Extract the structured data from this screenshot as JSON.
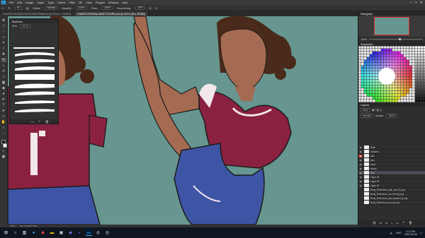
{
  "menubar": {
    "items": [
      "File",
      "Edit",
      "Image",
      "Layer",
      "Type",
      "Select",
      "Filter",
      "3D",
      "View",
      "Plugins",
      "Window",
      "Help"
    ]
  },
  "options": {
    "size_value": "92",
    "mode_label": "Mode:",
    "mode_value": "Normal",
    "opacity_label": "Opacity:",
    "opacity_value": "100%",
    "flow_label": "Flow:",
    "flow_value": "100%",
    "smoothing_label": "Smoothing:",
    "smoothing_value": "10%"
  },
  "tabs": [
    {
      "label": "CHARIE RHONDA SKETCHES Reflected @ 50% (L...RGB/8)",
      "active": false
    },
    {
      "label": "CHARIE RHONDA NEW FUTURE.psd @ 100% (Skn, RGB/8)",
      "active": true
    }
  ],
  "brushes": {
    "title": "Brushes",
    "size_label": "Size:",
    "size_value": "92 px"
  },
  "navigator": {
    "title": "Navigator",
    "zoom": "100%"
  },
  "swatches": {
    "title": "Swatches"
  },
  "layers": {
    "title": "Layers",
    "kind_label": "Kind",
    "blend": "Normal",
    "opacity_label": "Opacity:",
    "opacity": "100%",
    "lock_label": "Lock:",
    "fill_label": "Fill:",
    "fill": "100%",
    "items": [
      {
        "name": "Shirt",
        "vis": true,
        "red": false
      },
      {
        "name": "Outlines",
        "vis": true,
        "red": false
      },
      {
        "name": "hair",
        "vis": true,
        "red": true
      },
      {
        "name": "skin",
        "vis": true,
        "red": false
      },
      {
        "name": "head",
        "vis": true,
        "red": false
      },
      {
        "name": "shorts",
        "vis": true,
        "red": false
      },
      {
        "name": "Skn",
        "vis": true,
        "red": false
      },
      {
        "name": "Layer 48",
        "vis": true,
        "red": false
      },
      {
        "name": "Layer 46",
        "vis": true,
        "red": false
      },
      {
        "name": "Layer 49",
        "vis": true,
        "red": false
      },
      {
        "name": "Body_Reference_skin_mix (1).png",
        "vis": false,
        "red": false
      },
      {
        "name": "Body_Reference_bw_flat (2).png",
        "vis": false,
        "red": false
      },
      {
        "name": "Body_Reference_flat_shared (1).png",
        "vis": false,
        "red": false
      },
      {
        "name": "Body_Reference_bw (1).png",
        "vis": false,
        "red": false
      }
    ]
  },
  "status": {
    "zoom": "100%",
    "doc": "Doc: 35.4M/1.38G"
  },
  "taskbar": {
    "time": "2:11 PM",
    "date": "2022-05-06",
    "lang": "ENG"
  },
  "colors": {
    "canvas_bg": "#66968f",
    "shirt": "#8b2141",
    "shorts": "#3e55a6",
    "skin": "#a56b52",
    "hair": "#4a2a1a"
  }
}
